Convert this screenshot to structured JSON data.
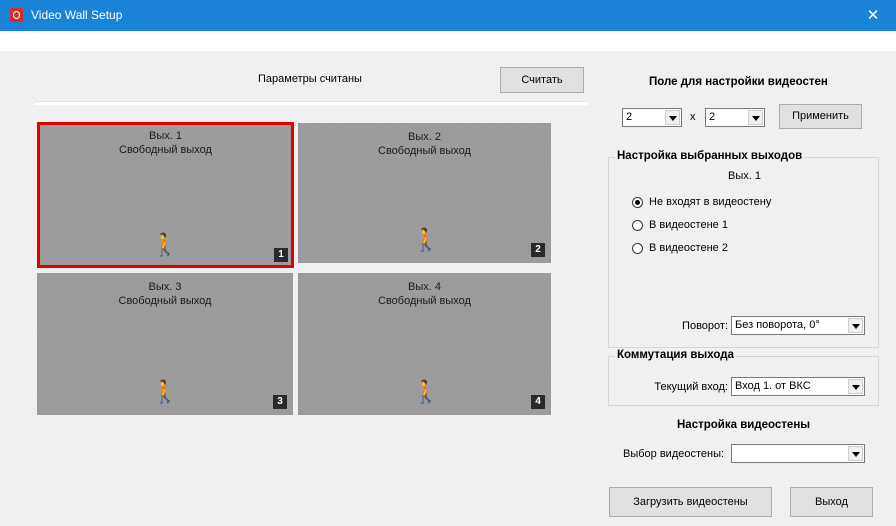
{
  "window": {
    "title": "Video Wall Setup",
    "close_glyph": "✕",
    "icon": "app-logo-icon"
  },
  "left": {
    "status_text": "Параметры считаны",
    "read_button": "Считать",
    "tiles": [
      {
        "line1": "Вых. 1",
        "line2": "Свободный выход",
        "number": "1",
        "selected": true
      },
      {
        "line1": "Вых. 2",
        "line2": "Свободный выход",
        "number": "2",
        "selected": false
      },
      {
        "line1": "Вых. 3",
        "line2": "Свободный выход",
        "number": "3",
        "selected": false
      },
      {
        "line1": "Вых. 4",
        "line2": "Свободный выход",
        "number": "4",
        "selected": false
      }
    ],
    "tile_icon": "walking-person-icon",
    "tile_glyph": "🚶",
    "accent": "#e00000"
  },
  "right": {
    "grid_heading": "Поле для настройки видеостен",
    "rows_value": "2",
    "x_label": "x",
    "cols_value": "2",
    "apply_button": "Применить",
    "outputs_group": {
      "legend": "Настройка выбранных выходов",
      "selected_output": "Вых. 1",
      "options": [
        {
          "label": "Не входят в видеостену",
          "checked": true
        },
        {
          "label": "В видеостене 1",
          "checked": false
        },
        {
          "label": "В видеостене 2",
          "checked": false
        }
      ],
      "rotation_label": "Поворот:",
      "rotation_value": "Без поворота, 0°"
    },
    "switch_group": {
      "legend": "Коммутация выхода",
      "input_label": "Текущий вход:",
      "input_value": "Вход 1. от ВКС"
    },
    "wall_heading": "Настройка видеостены",
    "wall_select_label": "Выбор видеостены:",
    "wall_select_value": "",
    "load_button": "Загрузить видеостены",
    "exit_button": "Выход"
  }
}
